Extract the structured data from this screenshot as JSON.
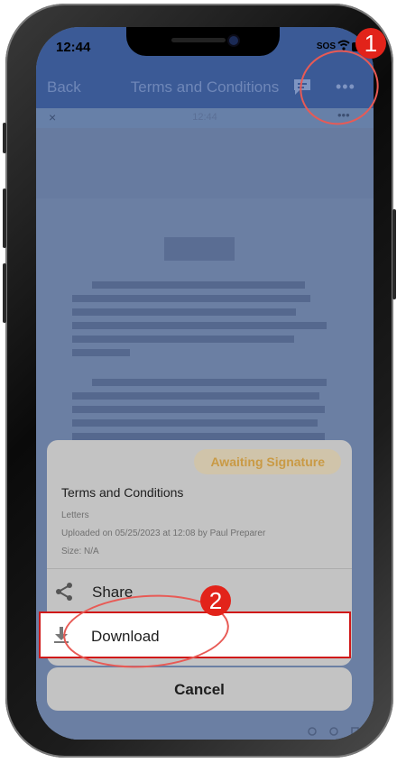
{
  "status_bar": {
    "time": "12:44",
    "carrier": "SOS"
  },
  "nav": {
    "back_label": "Back",
    "title": "Terms and Conditions",
    "more_label": "•••"
  },
  "viewer": {
    "close_label": "×",
    "time": "12:44",
    "more_label": "•••"
  },
  "sheet": {
    "badge": "Awaiting Signature",
    "doc_title": "Terms and Conditions",
    "category": "Letters",
    "uploaded": "Uploaded on 05/25/2023 at 12:08 by Paul Preparer",
    "size": "Size: N/A",
    "share_label": "Share",
    "download_label": "Download",
    "cancel_label": "Cancel"
  },
  "callouts": {
    "step1": "1",
    "step2": "2"
  },
  "colors": {
    "nav": "#3b5a96",
    "badge_text": "#c99a45",
    "callout": "#e2231a"
  }
}
